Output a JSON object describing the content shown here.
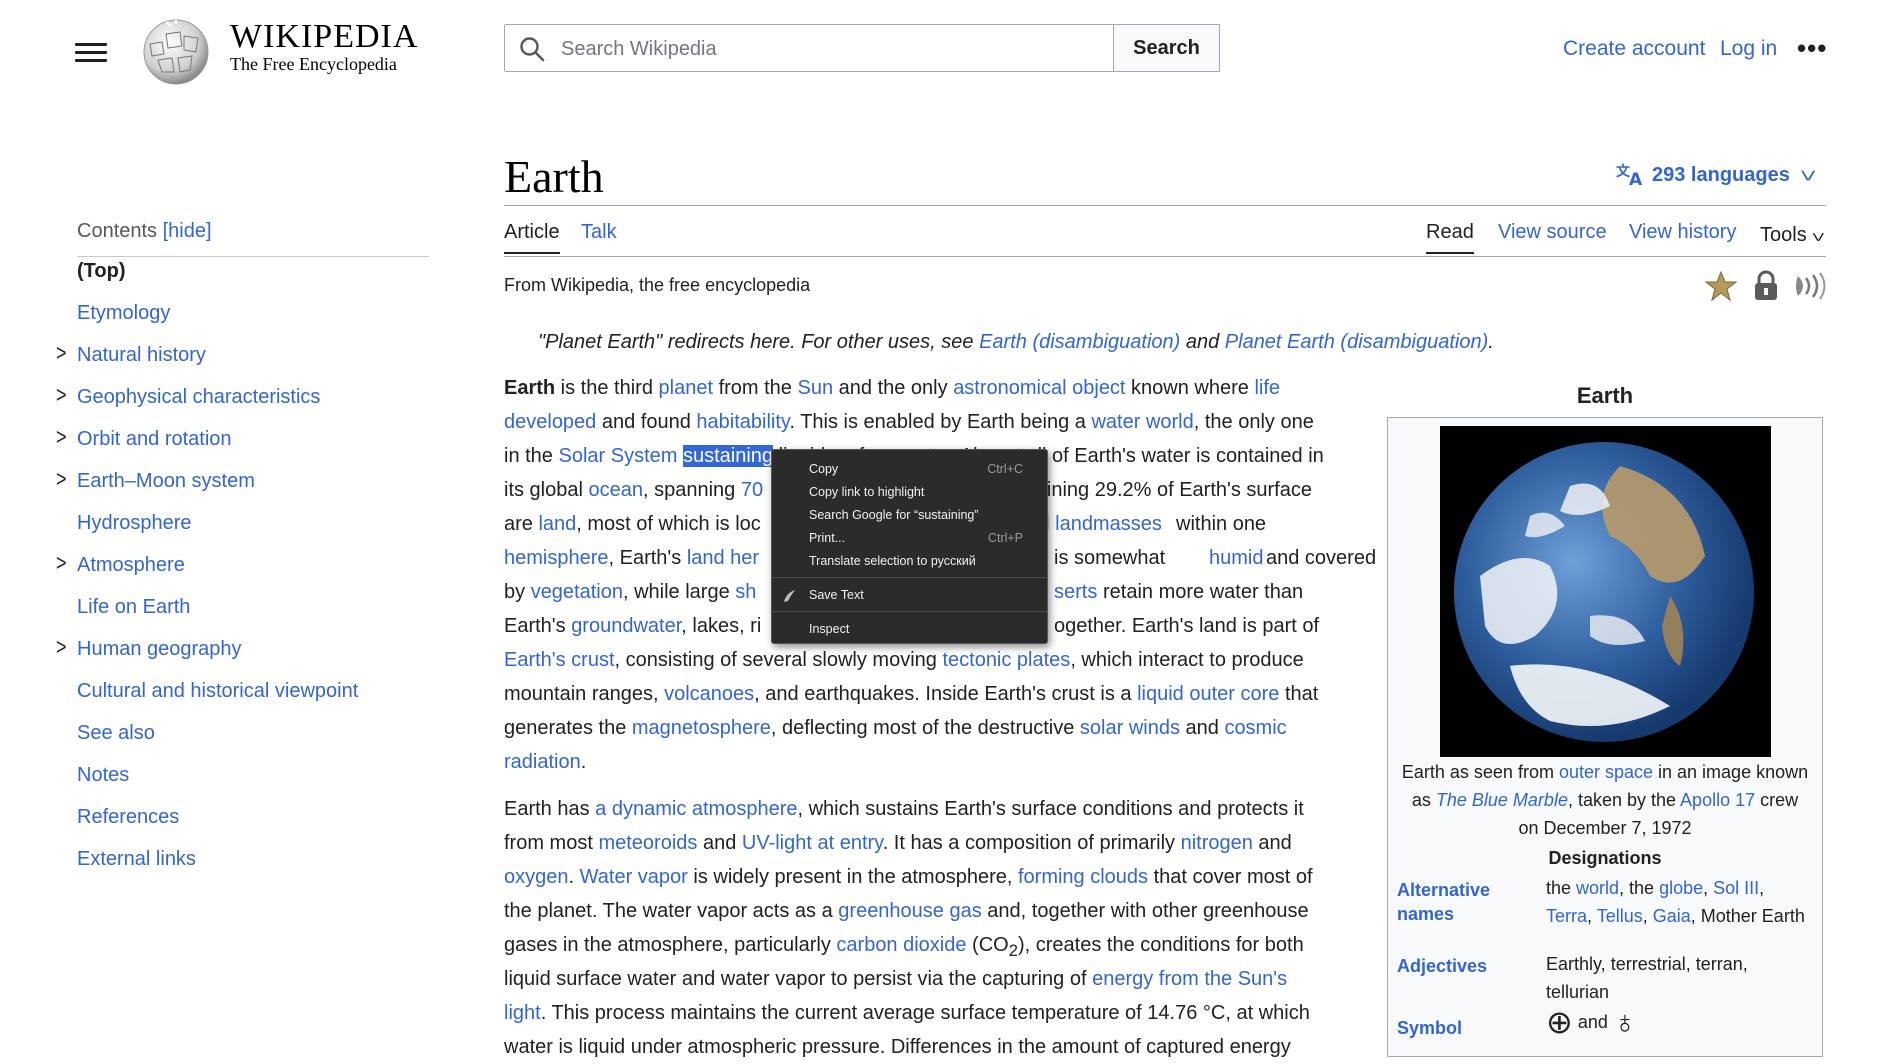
{
  "header": {
    "wordmark": "WIKIPEDIA",
    "tagline": "The Free Encyclopedia",
    "search_placeholder": "Search Wikipedia",
    "search_button": "Search",
    "create_account": "Create account",
    "log_in": "Log in",
    "more": "•••"
  },
  "toc": {
    "title": "Contents",
    "toggle": "[hide]",
    "items": [
      {
        "label": "(Top)"
      },
      {
        "label": "Etymology"
      },
      {
        "label": "Natural history"
      },
      {
        "label": "Geophysical characteristics"
      },
      {
        "label": "Orbit and rotation"
      },
      {
        "label": "Earth–Moon system"
      },
      {
        "label": "Hydrosphere"
      },
      {
        "label": "Atmosphere"
      },
      {
        "label": "Life on Earth"
      },
      {
        "label": "Human geography"
      },
      {
        "label": "Cultural and historical viewpoint"
      },
      {
        "label": "See also"
      },
      {
        "label": "Notes"
      },
      {
        "label": "References"
      },
      {
        "label": "External links"
      }
    ]
  },
  "page": {
    "title": "Earth",
    "languages": "293 languages",
    "tabs_left": [
      "Article",
      "Talk"
    ],
    "tabs_right": [
      "Read",
      "View source",
      "View history",
      "Tools"
    ],
    "from": "From Wikipedia, the free encyclopedia",
    "hatnote": {
      "prefix": "\"Planet Earth\" redirects here. For other uses, see ",
      "link1": "Earth (disambiguation)",
      "mid": " and ",
      "link2": "Planet Earth (disambiguation)",
      "suffix": "."
    }
  },
  "paragraph1": {
    "l1": {
      "a": "Earth",
      "b": " is the third ",
      "c": "planet",
      "d": " from the ",
      "e": "Sun",
      "f": " and the only ",
      "g": "astronomical object",
      "h": " known where ",
      "i": "life"
    },
    "l2": {
      "a": "developed",
      "b": " and found ",
      "c": "habitability",
      "d": ". This is enabled by Earth being a ",
      "e": "water world",
      "f": ", the only one"
    },
    "l3": {
      "a": "in the ",
      "b": "Solar System",
      "c": " ",
      "d": "sustaining",
      "e": " liquid surface water. Almost all of Earth's water is contained in"
    },
    "l4": {
      "a": "its global ",
      "b": "ocean",
      "c": ", spanning ",
      "d": "70",
      "e": "emaining 29.2% of Earth's surface"
    },
    "l5": {
      "a": "are ",
      "b": "land",
      "c": ", most of which is loc",
      "d": "al landmasses",
      "e": " within one"
    },
    "l6": {
      "a": "hemisphere",
      "b": ", Earth's ",
      "c": "land her",
      "d": " is somewhat ",
      "e": "humid",
      "f": " and covered"
    },
    "l7": {
      "a": "by ",
      "b": "vegetation",
      "c": ", while large ",
      "d": "sh",
      "e": "serts",
      "f": " retain more water than"
    },
    "l8": {
      "a": "Earth's ",
      "b": "groundwater",
      "c": ", lakes, ri",
      "d": "ogether. Earth's land is part of"
    },
    "l9": {
      "a": "Earth's crust",
      "b": ", consisting of several slowly moving ",
      "c": "tectonic plates",
      "d": ", which interact to produce"
    },
    "l10": {
      "a": "mountain ranges, ",
      "b": "volcanoes",
      "c": ", and earthquakes. Inside Earth's crust is a ",
      "d": "liquid outer core",
      "e": " that"
    },
    "l11": {
      "a": "generates the ",
      "b": "magnetosphere",
      "c": ", deflecting most of the destructive ",
      "d": "solar winds",
      "e": " and ",
      "f": "cosmic"
    },
    "l12": {
      "a": "radiation",
      "b": "."
    }
  },
  "paragraph2": {
    "l1": {
      "a": "Earth has ",
      "b": "a dynamic atmosphere",
      "c": ", which sustains Earth's surface conditions and protects it"
    },
    "l2": {
      "a": "from most ",
      "b": "meteoroids",
      "c": " and ",
      "d": "UV-light at entry",
      "e": ". It has a composition of primarily ",
      "f": "nitrogen",
      "g": " and"
    },
    "l3": {
      "a": "oxygen",
      "b": ". ",
      "c": "Water vapor",
      "d": " is widely present in the atmosphere, ",
      "e": "forming clouds",
      "f": " that cover most of"
    },
    "l4": {
      "a": "the planet. The water vapor acts as a ",
      "b": "greenhouse gas",
      "c": " and, together with other greenhouse"
    },
    "l5": {
      "a": "gases in the atmosphere, particularly ",
      "b": "carbon dioxide",
      "c": " (CO",
      "d": "2",
      "e": "), creates the conditions for both"
    },
    "l6": {
      "a": "liquid surface water and water vapor to persist via the capturing of ",
      "b": "energy from the Sun's"
    },
    "l7": {
      "a": "light",
      "b": ". This process maintains the current average surface temperature of 14.76 °C, at which"
    },
    "l8": {
      "a": "water is liquid under atmospheric pressure. Differences in the amount of captured energy"
    }
  },
  "context_menu": {
    "items": [
      {
        "label": "Copy",
        "shortcut": "Ctrl+C"
      },
      {
        "label": "Copy link to highlight",
        "shortcut": ""
      },
      {
        "label": "Search Google for “sustaining”",
        "shortcut": ""
      },
      {
        "label": "Print...",
        "shortcut": "Ctrl+P"
      },
      {
        "label": "Translate selection to русский",
        "shortcut": ""
      },
      {
        "label": "Save Text",
        "shortcut": ""
      },
      {
        "label": "Inspect",
        "shortcut": ""
      }
    ]
  },
  "infobox": {
    "caption": "Earth",
    "image_caption": {
      "a": "Earth as seen from ",
      "b": "outer space",
      "c": " in an image known",
      "d": "as ",
      "e": "The Blue Marble",
      "f": ", taken by the ",
      "g": "Apollo 17",
      "h": " crew",
      "i": "on December 7, 1972"
    },
    "section": "Designations",
    "alt_names_label": "Alternative names",
    "alt_names": {
      "a": "the ",
      "b": "world",
      "c": ", the ",
      "d": "globe",
      "e": ", ",
      "f": "Sol III",
      "g": ",",
      "h": "Terra",
      "i": ", ",
      "j": "Tellus",
      "k": ", ",
      "l": "Gaia",
      "m": ", Mother Earth"
    },
    "adjectives_label": "Adjectives",
    "adjectives": {
      "a": "Earthly, terrestrial, terran,",
      "b": "tellurian"
    },
    "symbol_label": "Symbol",
    "symbol_and": "and",
    "symbol1": "⊕",
    "symbol2": "♁"
  },
  "colors": {
    "link": "#3366cc",
    "selection": "#3367d6",
    "menu_bg": "#2b2b2b"
  }
}
